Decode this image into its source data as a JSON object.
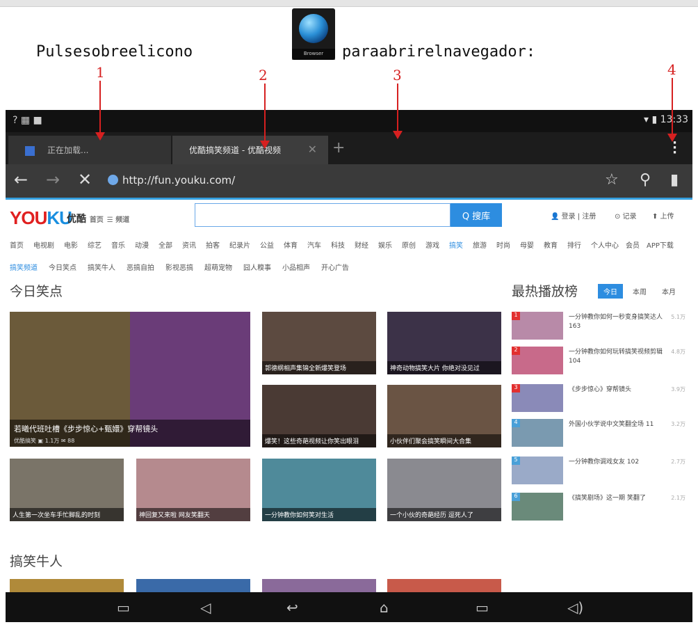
{
  "instruction": {
    "before": "Pulsesobreelicono",
    "after": "paraabrirelnavegador:",
    "icon_name": "browser-globe-icon",
    "icon_caption": "Browser"
  },
  "callouts": [
    "1",
    "2",
    "3",
    "4"
  ],
  "status_bar": {
    "time": "13:33",
    "left_icons": "? ▦ ■"
  },
  "tabs": [
    {
      "label": "正在加载..."
    },
    {
      "label": "优酷搞笑频道 - 优酷视频"
    }
  ],
  "url_bar": {
    "url": "http://fun.youku.com/"
  },
  "youku": {
    "logo_a": "YOU",
    "logo_b": "KU",
    "logo_cn": "优酷",
    "home": "首页",
    "channel": "☰ 频道",
    "search_button": "Q 搜库",
    "header_links": [
      "👤 登录 | 注册",
      "⊙ 记录",
      "⬆ 上传"
    ],
    "nav_main": [
      "首页",
      "电视剧",
      "电影",
      "综艺",
      "音乐",
      "动漫",
      "全部",
      "资讯",
      "拍客",
      "纪录片",
      "公益",
      "体育",
      "汽车",
      "科技",
      "财经",
      "娱乐",
      "原创",
      "游戏",
      "搞笑",
      "旅游",
      "时尚",
      "母婴",
      "教育",
      "排行"
    ],
    "nav_selected": "搞笑",
    "nav_right": [
      "个人中心",
      "会员",
      "APP下载"
    ],
    "nav_sub": [
      "搞笑频道",
      "今日笑点",
      "搞笑牛人",
      "恶搞自拍",
      "影视恶搞",
      "超萌宠物",
      "囧人糗事",
      "小品相声",
      "开心广告"
    ],
    "section1": "今日笑点",
    "section2": "搞笑牛人",
    "rank_title": "最热播放榜",
    "rank_tabs": [
      "今日",
      "本周",
      "本月"
    ],
    "videos": [
      "若曦代班吐槽《步步惊心+甄嬛》穿帮镜头",
      "郭德纲相声集锦全新爆笑登场",
      "神奇动物搞笑大片 你绝对没见过",
      "爆笑！这些奇葩视频让你笑出眼泪",
      "小伙伴们聚会搞笑瞬间大合集",
      "人生第一次坐车手忙脚乱的时刻",
      "神回复又来啦 网友笑翻天",
      "一分钟教你如何笑对生活",
      "一个小伙的奇葩经历 逗死人了"
    ],
    "hero_meta": "优酷搞笑 ▣ 1.1万 ✉ 88",
    "rank_items": [
      {
        "text": "一分钟教你如何一秒变身搞笑达人 163",
        "views": "5.1万"
      },
      {
        "text": "一分钟教你如何玩转搞笑视频剪辑 104",
        "views": "4.8万"
      },
      {
        "text": "《步步惊心》穿帮镜头",
        "views": "3.9万"
      },
      {
        "text": "外国小伙学说中文笑翻全场 11",
        "views": "3.2万"
      },
      {
        "text": "一分钟教你调戏女友 102",
        "views": "2.7万"
      },
      {
        "text": "《搞笑剧场》这一期 笑翻了",
        "views": "2.1万"
      }
    ]
  },
  "colors": {
    "accent": "#d62020",
    "youku_red": "#e02020",
    "youku_blue": "#2d8de0"
  }
}
